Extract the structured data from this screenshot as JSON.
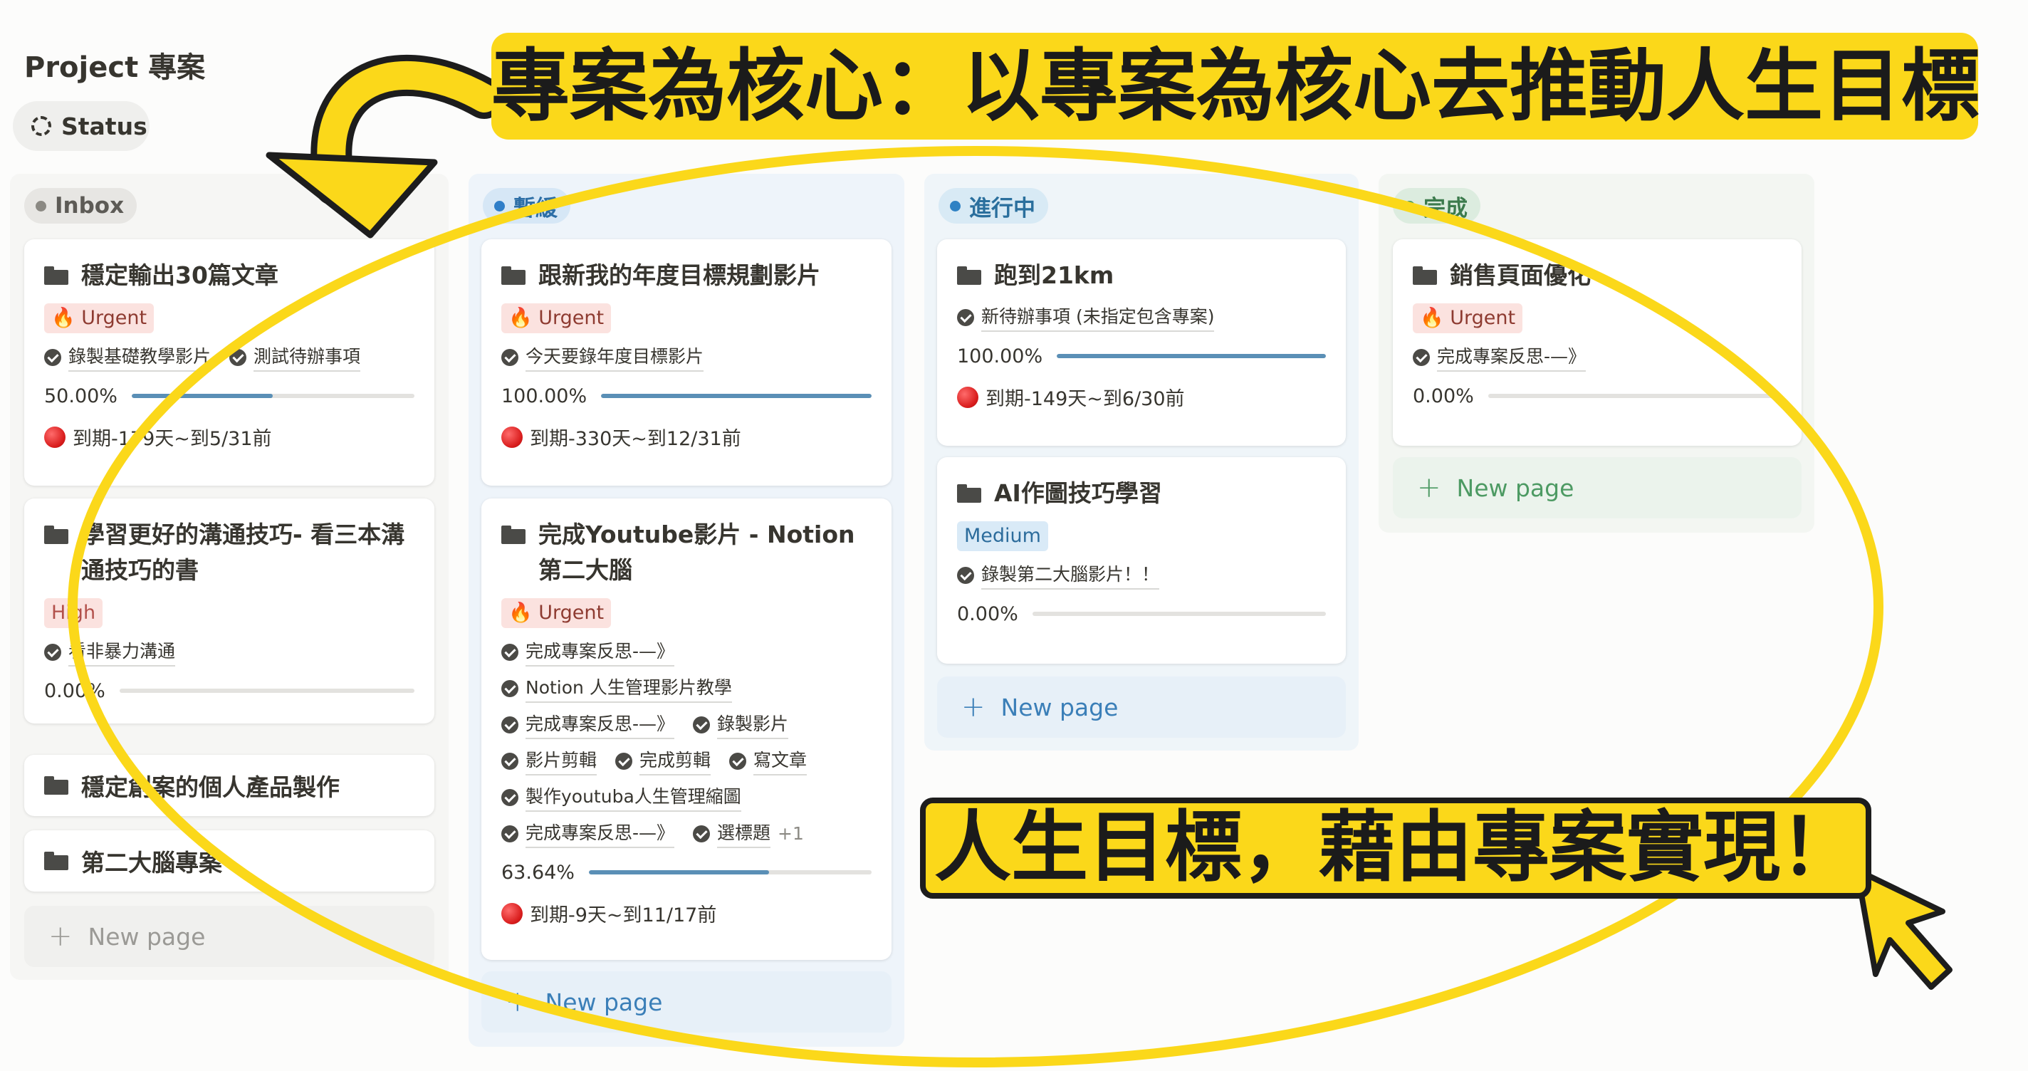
{
  "page": {
    "title": "Project 專案",
    "view_chip": "Status"
  },
  "columns": [
    {
      "name": "Inbox",
      "cards": [
        {
          "title": "穩定輸出30篇文章",
          "tag": "🔥 Urgent",
          "tasks": [
            "錄製基礎教學影片",
            "測試待辦事項"
          ],
          "progress_text": "50.00%",
          "progress": 0.5,
          "due": "到期-179天~到5/31前"
        },
        {
          "title": "學習更好的溝通技巧- 看三本溝通技巧的書",
          "tag": "High",
          "tasks": [
            "看非暴力溝通"
          ],
          "progress_text": "0.00%",
          "progress": 0.0
        },
        {
          "title": "穩定創案的個人產品製作"
        },
        {
          "title": "第二大腦專案"
        }
      ],
      "new_page": "New page"
    },
    {
      "name": "暫緩",
      "cards": [
        {
          "title": "跟新我的年度目標規劃影片",
          "tag": "🔥 Urgent",
          "tasks": [
            "今天要錄年度目標影片"
          ],
          "progress_text": "100.00%",
          "progress": 1.0,
          "due": "到期-330天~到12/31前"
        },
        {
          "title": "完成Youtube影片 - Notion第二大腦",
          "tag": "🔥 Urgent",
          "tasks": [
            "完成專案反思-—》",
            "Notion 人生管理影片教學",
            "完成專案反思-—》",
            "錄製影片",
            "影片剪輯",
            "完成剪輯",
            "寫文章",
            "製作youtuba人生管理縮圖",
            "完成專案反思-—》",
            "選標題"
          ],
          "more": "+1",
          "progress_text": "63.64%",
          "progress": 0.6364,
          "due": "到期-9天~到11/17前"
        }
      ],
      "new_page": "New page"
    },
    {
      "name": "進行中",
      "cards": [
        {
          "title": "跑到21km",
          "tasks": [
            "新待辦事項 (未指定包含專案)"
          ],
          "progress_text": "100.00%",
          "progress": 1.0,
          "due": "到期-149天~到6/30前"
        },
        {
          "title": "AI作圖技巧學習",
          "tag": "Medium",
          "tasks": [
            "錄製第二大腦影片！！"
          ],
          "progress_text": "0.00%",
          "progress": 0.0
        }
      ],
      "new_page": "New page"
    },
    {
      "name": "完成",
      "cards": [
        {
          "title": "銷售頁面優化",
          "tag": "🔥 Urgent",
          "tasks": [
            "完成專案反思-—》"
          ],
          "progress_text": "0.00%",
          "progress": 0.0
        }
      ],
      "new_page": "New page"
    }
  ],
  "annotations": {
    "top_banner": "專案為核心：以專案為核心去推動人生目標",
    "bottom_banner": "人生目標，藉由專案實現！",
    "highlight_color": "#fbd81a"
  },
  "colors": {
    "progress_fill": "#5a8fb6",
    "urgent_bg": "#fbe2df",
    "due_dot": "#d91d1d"
  }
}
